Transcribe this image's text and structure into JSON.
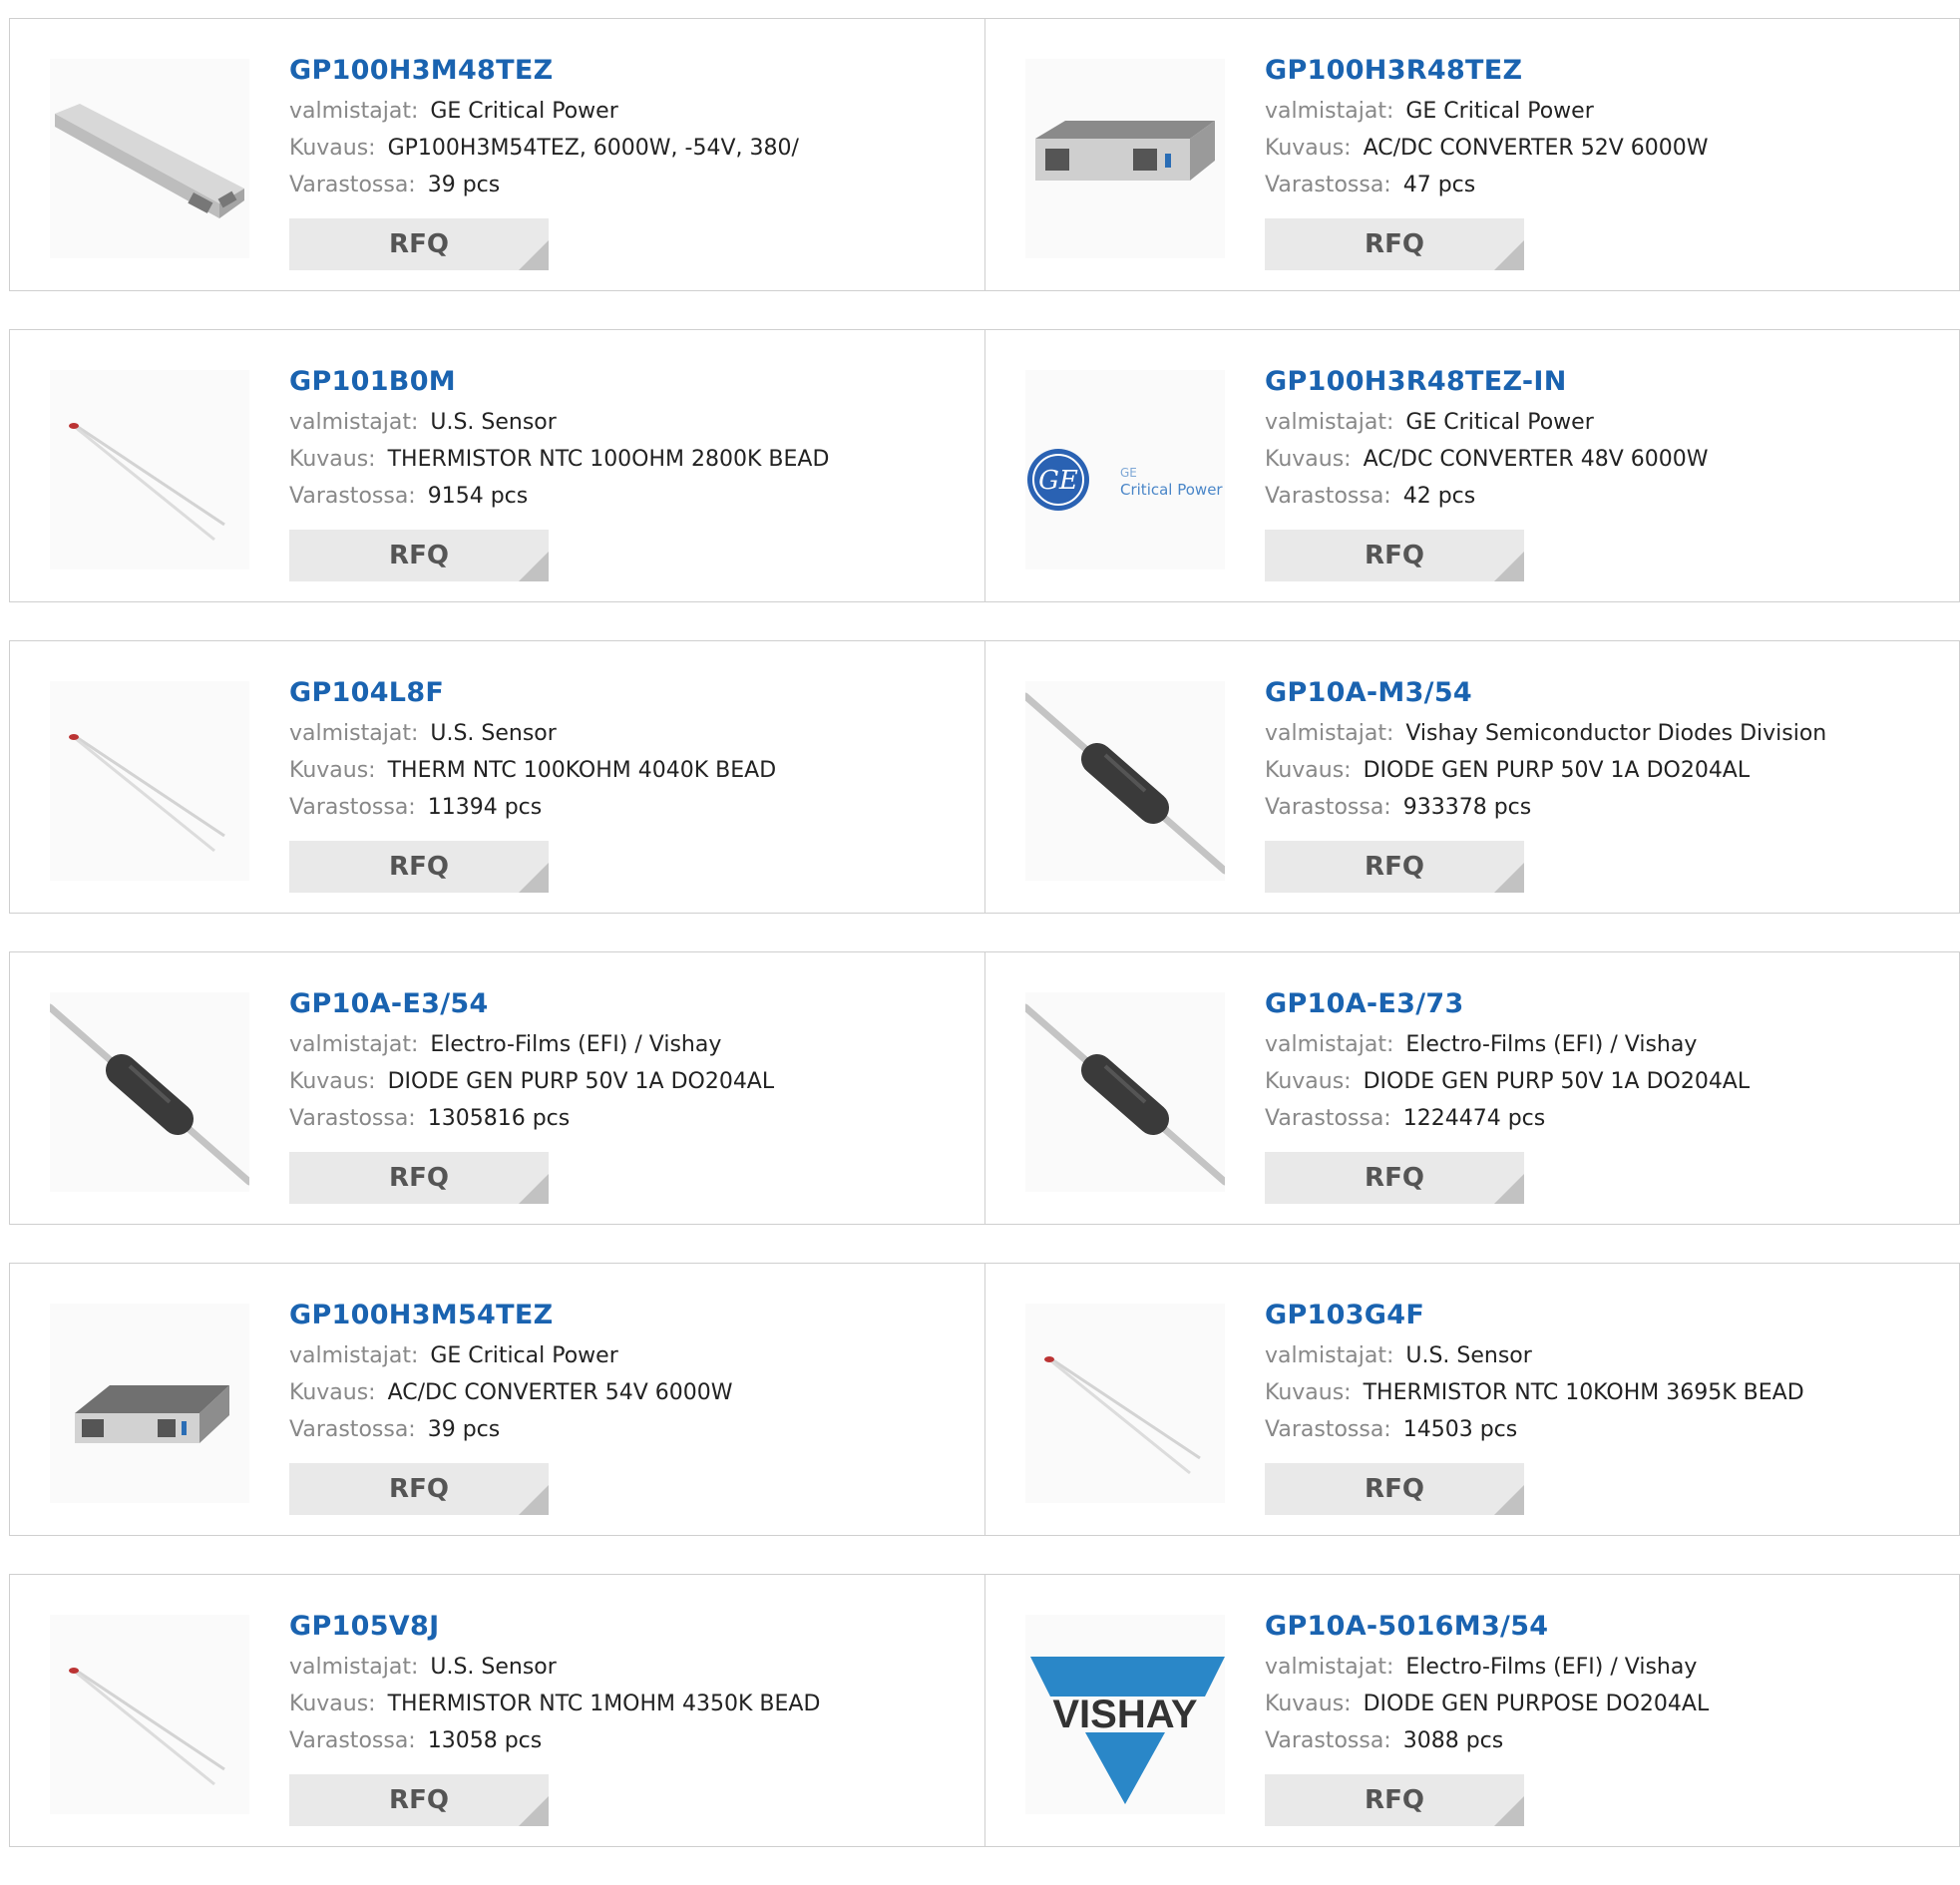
{
  "labels": {
    "manufacturer": "valmistajat:",
    "description": "Kuvaus:",
    "stock": "Varastossa:",
    "rfq": "RFQ"
  },
  "products": [
    {
      "part": "GP100H3M48TEZ",
      "manufacturer": "GE Critical Power",
      "description": "GP100H3M54TEZ, 6000W, -54V, 380/",
      "stock": "39 pcs",
      "image": "rack-module-flat"
    },
    {
      "part": "GP100H3R48TEZ",
      "manufacturer": "GE Critical Power",
      "description": "AC/DC CONVERTER 52V 6000W",
      "stock": "47 pcs",
      "image": "rack-unit"
    },
    {
      "part": "GP101B0M",
      "manufacturer": "U.S. Sensor",
      "description": "THERMISTOR NTC 100OHM 2800K BEAD",
      "stock": "9154 pcs",
      "image": "thermistor-bead"
    },
    {
      "part": "GP100H3R48TEZ-IN",
      "manufacturer": "GE Critical Power",
      "description": "AC/DC CONVERTER 48V 6000W",
      "stock": "42 pcs",
      "image": "ge-logo"
    },
    {
      "part": "GP104L8F",
      "manufacturer": "U.S. Sensor",
      "description": "THERM NTC 100KOHM 4040K BEAD",
      "stock": "11394 pcs",
      "image": "thermistor-bead"
    },
    {
      "part": "GP10A-M3/54",
      "manufacturer": "Vishay Semiconductor Diodes Division",
      "description": "DIODE GEN PURP 50V 1A DO204AL",
      "stock": "933378 pcs",
      "image": "axial-diode"
    },
    {
      "part": "GP10A-E3/54",
      "manufacturer": "Electro-Films (EFI) / Vishay",
      "description": "DIODE GEN PURP 50V 1A DO204AL",
      "stock": "1305816 pcs",
      "image": "axial-diode"
    },
    {
      "part": "GP10A-E3/73",
      "manufacturer": "Electro-Films (EFI) / Vishay",
      "description": "DIODE GEN PURP 50V 1A DO204AL",
      "stock": "1224474 pcs",
      "image": "axial-diode"
    },
    {
      "part": "GP100H3M54TEZ",
      "manufacturer": "GE Critical Power",
      "description": "AC/DC CONVERTER 54V 6000W",
      "stock": "39 pcs",
      "image": "rack-unit-small"
    },
    {
      "part": "GP103G4F",
      "manufacturer": "U.S. Sensor",
      "description": "THERMISTOR NTC 10KOHM 3695K BEAD",
      "stock": "14503 pcs",
      "image": "thermistor-bead"
    },
    {
      "part": "GP105V8J",
      "manufacturer": "U.S. Sensor",
      "description": "THERMISTOR NTC 1MOHM 4350K BEAD",
      "stock": "13058 pcs",
      "image": "thermistor-bead"
    },
    {
      "part": "GP10A-5016M3/54",
      "manufacturer": "Electro-Films (EFI) / Vishay",
      "description": "DIODE GEN PURPOSE DO204AL",
      "stock": "3088 pcs",
      "image": "vishay-logo"
    }
  ],
  "logos": {
    "ge_text_1": "GE",
    "ge_text_2": "Critical Power",
    "vishay_text": "VISHAY"
  },
  "colors": {
    "part_link": "#1a63b0",
    "label": "#888888",
    "rfq_bg": "#e9e9e9",
    "border": "#cfcfcf"
  }
}
